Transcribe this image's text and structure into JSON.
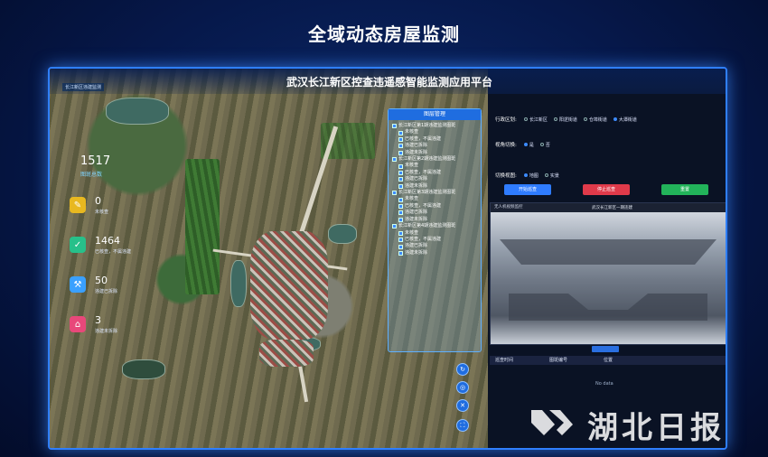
{
  "outer_title": "全域动态房屋监测",
  "platform_title": "武汉长江新区控查违遥感智能监测应用平台",
  "corner_tag": "长江新区违建监测",
  "stats": {
    "total": {
      "value": "1517",
      "label": "图斑总数"
    },
    "items": [
      {
        "value": "0",
        "label": "未核查",
        "icon": "check-doc-icon",
        "color": "#e8b820"
      },
      {
        "value": "1464",
        "label": "已核查，不属违建",
        "icon": "verified-doc-icon",
        "color": "#27c08a"
      },
      {
        "value": "50",
        "label": "违建已拆除",
        "icon": "demolish-icon",
        "color": "#3aa0ff"
      },
      {
        "value": "3",
        "label": "违建未拆除",
        "icon": "house-alert-icon",
        "color": "#e8487a"
      }
    ]
  },
  "layer_panel": {
    "title": "图层管理",
    "items": [
      {
        "label": "长江新区第1期违建监测图斑",
        "level": 0
      },
      {
        "label": "未核查",
        "level": 1
      },
      {
        "label": "已核查，不属违建",
        "level": 1
      },
      {
        "label": "违建已拆除",
        "level": 1
      },
      {
        "label": "违建未拆除",
        "level": 1
      },
      {
        "label": "长江新区第2期违建监测图斑",
        "level": 0
      },
      {
        "label": "未核查",
        "level": 1
      },
      {
        "label": "已核查，不属违建",
        "level": 1
      },
      {
        "label": "违建已拆除",
        "level": 1
      },
      {
        "label": "违建未拆除",
        "level": 1
      },
      {
        "label": "长江新区第3期违建监测图斑",
        "level": 0
      },
      {
        "label": "未核查",
        "level": 1
      },
      {
        "label": "已核查，不属违建",
        "level": 1
      },
      {
        "label": "违建已拆除",
        "level": 1
      },
      {
        "label": "违建未拆除",
        "level": 1
      },
      {
        "label": "长江新区第4期违建监测图斑",
        "level": 0
      },
      {
        "label": "未核查",
        "level": 1
      },
      {
        "label": "已核查，不属违建",
        "level": 1
      },
      {
        "label": "违建已拆除",
        "level": 1
      },
      {
        "label": "违建未拆除",
        "level": 1
      }
    ]
  },
  "form": {
    "row1": {
      "label": "行政区划:",
      "options": [
        "长江新区",
        "阳逻街道",
        "仓埠街道",
        "大潭街道"
      ]
    },
    "row2": {
      "label": "视角切换:",
      "options": [
        "是",
        "否"
      ]
    },
    "row3": {
      "label": "切换视图:",
      "options": [
        "地图",
        "实景"
      ]
    }
  },
  "buttons": {
    "start": "开始巡查",
    "stop": "停止巡查",
    "reset": "重置"
  },
  "video": {
    "bar_text": "无人机视频监控",
    "title": "武汉长江新区一期违建"
  },
  "table": {
    "columns": [
      "巡查时间",
      "图斑编号",
      "位置"
    ],
    "empty": "No data"
  },
  "watermark": {
    "text": "湖北日报"
  }
}
